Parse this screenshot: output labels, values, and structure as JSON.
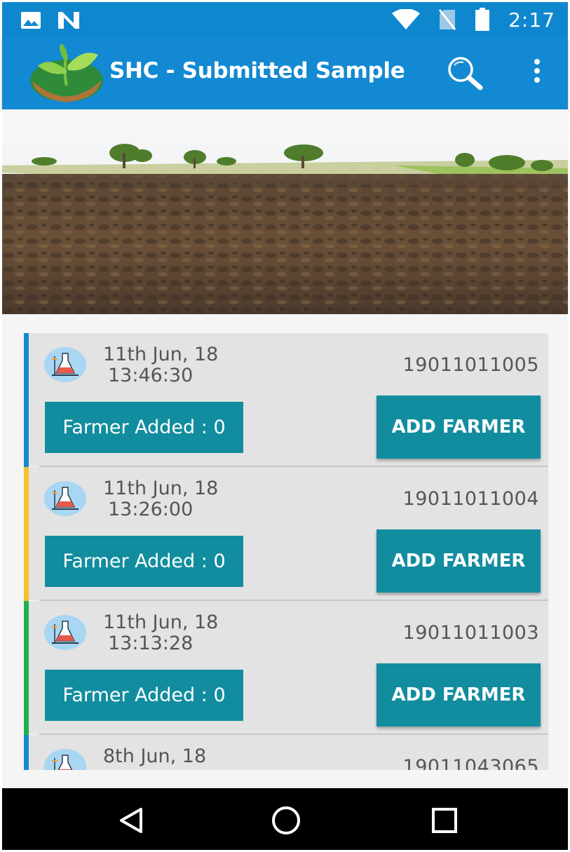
{
  "status_bar": {
    "time": "2:17",
    "left_icons": [
      "image-icon",
      "n-notification-icon"
    ],
    "right_icons": [
      "wifi-icon",
      "no-sim-icon",
      "battery-icon"
    ]
  },
  "app_bar": {
    "title": "SHC - Submitted Sample",
    "logo_icon": "soil-leaf-logo-icon",
    "search_icon": "search-icon",
    "menu_icon": "more-vert-icon"
  },
  "samples": [
    {
      "date": "11th Jun, 18",
      "time": "13:46:30",
      "id": "19011011005",
      "farmer_added": "Farmer Added : 0",
      "action": "ADD FARMER",
      "accent": "#1488cf"
    },
    {
      "date": "11th Jun, 18",
      "time": "13:26:00",
      "id": "19011011004",
      "farmer_added": "Farmer Added : 0",
      "action": "ADD FARMER",
      "accent": "#f2c12e"
    },
    {
      "date": "11th Jun, 18",
      "time": "13:13:28",
      "id": "19011011003",
      "farmer_added": "Farmer Added : 0",
      "action": "ADD FARMER",
      "accent": "#1fb14c"
    },
    {
      "date": "8th Jun, 18",
      "time": "",
      "id": "19011043065",
      "farmer_added": "",
      "action": "",
      "accent": "#1488cf"
    }
  ],
  "nav_bar": {
    "buttons": [
      "back-triangle-icon",
      "home-circle-icon",
      "recents-square-icon"
    ]
  },
  "colors": {
    "primary": "#1289d2",
    "button": "#118d9f"
  }
}
